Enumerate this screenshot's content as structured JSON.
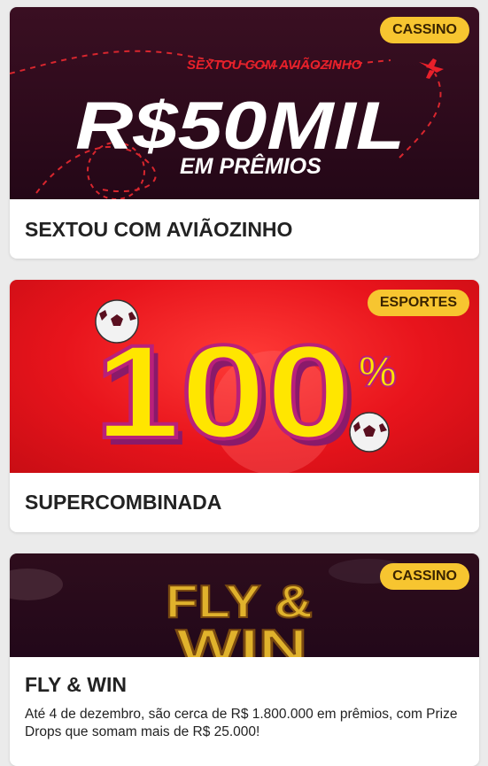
{
  "promotions": [
    {
      "category_badge": "CASSINO",
      "title": "SEXTOU COM AVIÃOZINHO",
      "banner": {
        "tagline": "SEXTOU COM AVIÃOZINHO",
        "headline": "R$50MIL",
        "subheadline": "EM PRÊMIOS"
      }
    },
    {
      "category_badge": "ESPORTES",
      "title": "SUPERCOMBINADA",
      "banner": {
        "headline": "100",
        "percent": "%"
      }
    },
    {
      "category_badge": "CASSINO",
      "title": "FLY & WIN",
      "description": "Até 4 de dezembro, são cerca de R$ 1.800.000 em prêmios, com Prize Drops que somam mais de R$ 25.000!",
      "banner": {
        "logo_line1": "FLY &",
        "logo_line2": "WIN"
      }
    }
  ],
  "colors": {
    "badge_bg": "#f7c530",
    "banner1_bg": "#2b0a1a",
    "banner2_bg": "#e8141c",
    "banner3_bg": "#2a0a18",
    "accent_red": "#e8202a",
    "yellow": "#ffe600"
  }
}
